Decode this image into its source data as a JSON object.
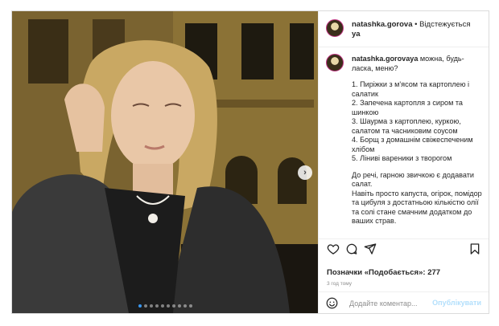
{
  "post": {
    "username": "natashka.gorova",
    "follow_label": "• Відстежується",
    "username_wrap": "ya",
    "caption_user": "natashka.gorovaya",
    "caption_intro": "можна, будь-ласка, меню?",
    "menu": [
      "1. Пиріжки з м'ясом та картоплею і салатик",
      "2. Запечена картопля з сиром та шинкою",
      "3. Шаурма з картоплею, куркою, салатом та часниковим соусом",
      "4. Борщ з домашнім свіжеспеченим хлібом",
      "5. Ліниві вареники з творогом"
    ],
    "paragraph1": "До речі, гарною звичкою є додавати салат.",
    "paragraph2": "Навіть просто капуста, огірок, помідор та цибуля з достатньою кількістю олії та солі стане смачним додатком до ваших страв.",
    "likes": "Позначки «Подобається»: 277",
    "time": "3 год тому",
    "comment_placeholder": "Додайте коментар...",
    "publish_label": "Опублікувати",
    "carousel_dots": 10,
    "active_dot": 0
  },
  "icons": {
    "heart": "heart-icon",
    "comment": "comment-icon",
    "share": "share-icon",
    "save": "bookmark-icon",
    "emoji": "emoji-icon",
    "next": "chevron-right-icon"
  },
  "colors": {
    "link_blue": "#3897f0",
    "publish_disabled": "#b2dffc",
    "avatar_ring": "#c13584"
  }
}
